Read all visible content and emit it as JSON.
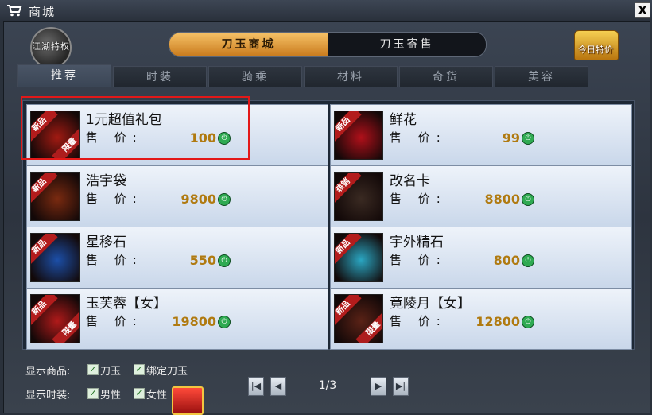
{
  "window": {
    "title": "商城",
    "close_label": "X"
  },
  "badge": {
    "text": "江湖特权"
  },
  "main_tabs": [
    {
      "label": "刀玉商城",
      "active": true
    },
    {
      "label": "刀玉寄售",
      "active": false
    }
  ],
  "daily_offer": {
    "label": "今日特价"
  },
  "sub_tabs": [
    {
      "label": "推荐",
      "active": true
    },
    {
      "label": "时装"
    },
    {
      "label": "骑乘"
    },
    {
      "label": "材料"
    },
    {
      "label": "奇货"
    },
    {
      "label": "美容"
    }
  ],
  "price_label": "售 价:",
  "items": [
    {
      "name": "1元超值礼包",
      "price": "100",
      "ribbon": "新品",
      "limited": "限量",
      "icon": "gift-pack-icon",
      "color": "#a11a12"
    },
    {
      "name": "鲜花",
      "price": "99",
      "ribbon": "新品",
      "limited": "",
      "icon": "rose-icon",
      "color": "#b0101a"
    },
    {
      "name": "浩宇袋",
      "price": "9800",
      "ribbon": "新品",
      "limited": "",
      "icon": "bag-icon",
      "color": "#7a2a10"
    },
    {
      "name": "改名卡",
      "price": "8800",
      "ribbon": "热销",
      "limited": "",
      "icon": "rename-card-icon",
      "color": "#3a2a22"
    },
    {
      "name": "星移石",
      "price": "550",
      "ribbon": "新品",
      "limited": "",
      "icon": "blue-stone-icon",
      "color": "#1c4fa8"
    },
    {
      "name": "宇外精石",
      "price": "800",
      "ribbon": "新品",
      "limited": "",
      "icon": "crystal-icon",
      "color": "#2aa6c2"
    },
    {
      "name": "玉芙蓉【女】",
      "price": "19800",
      "ribbon": "新品",
      "limited": "限量",
      "icon": "female-outfit-icon",
      "color": "#b01a1a"
    },
    {
      "name": "竟陵月【女】",
      "price": "12800",
      "ribbon": "新品",
      "limited": "限量",
      "icon": "female-outfit-icon",
      "color": "#5a2216"
    }
  ],
  "filters": {
    "goods_label": "显示商品:",
    "goods_options": [
      "刀玉",
      "绑定刀玉"
    ],
    "fashion_label": "显示时装:",
    "fashion_options": [
      "男性",
      "女性"
    ]
  },
  "pagination": {
    "page": "1/3"
  }
}
